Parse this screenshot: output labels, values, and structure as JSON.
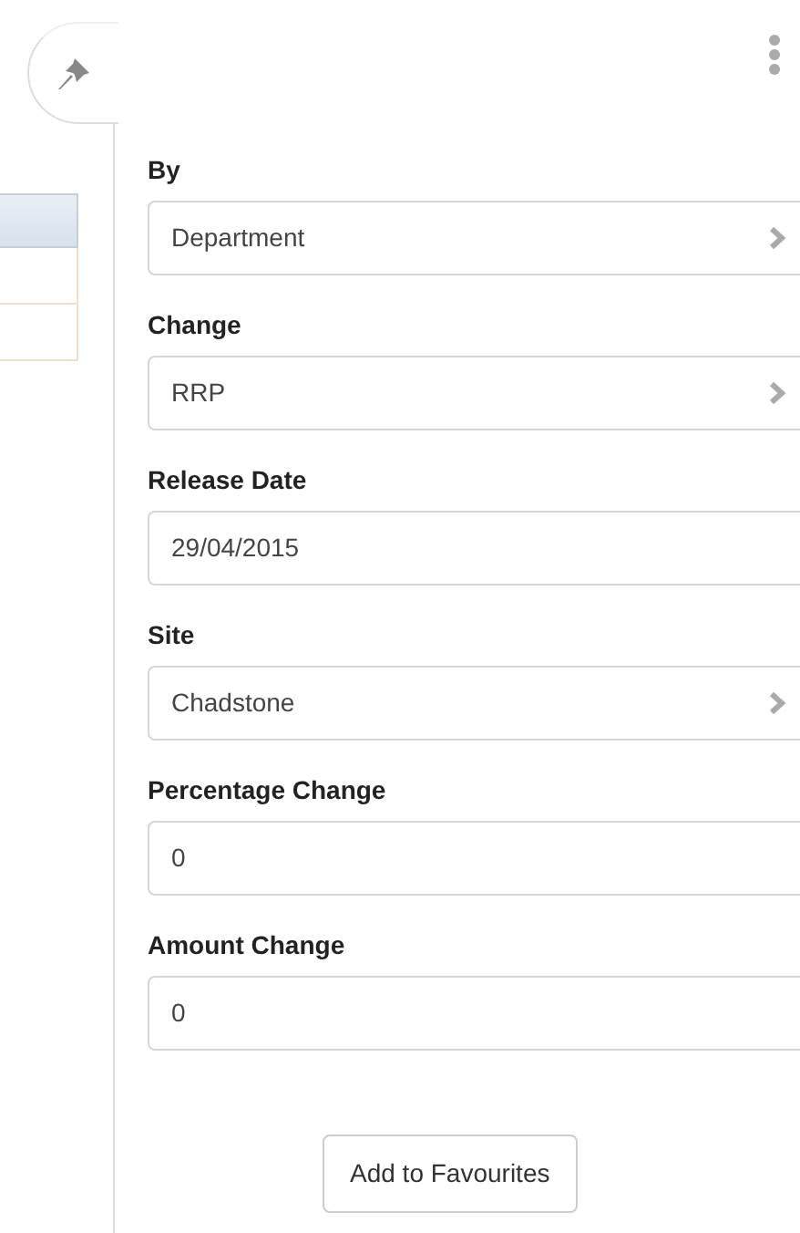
{
  "fields": [
    {
      "label": "By",
      "kind": "select",
      "value": "Department"
    },
    {
      "label": "Change",
      "kind": "select",
      "value": "RRP"
    },
    {
      "label": "Release Date",
      "kind": "input",
      "value": "29/04/2015"
    },
    {
      "label": "Site",
      "kind": "select",
      "value": "Chadstone"
    },
    {
      "label": "Percentage Change",
      "kind": "input",
      "value": "0"
    },
    {
      "label": "Amount Change",
      "kind": "input",
      "value": "0"
    }
  ],
  "buttons": [
    "Add to Favourites"
  ]
}
